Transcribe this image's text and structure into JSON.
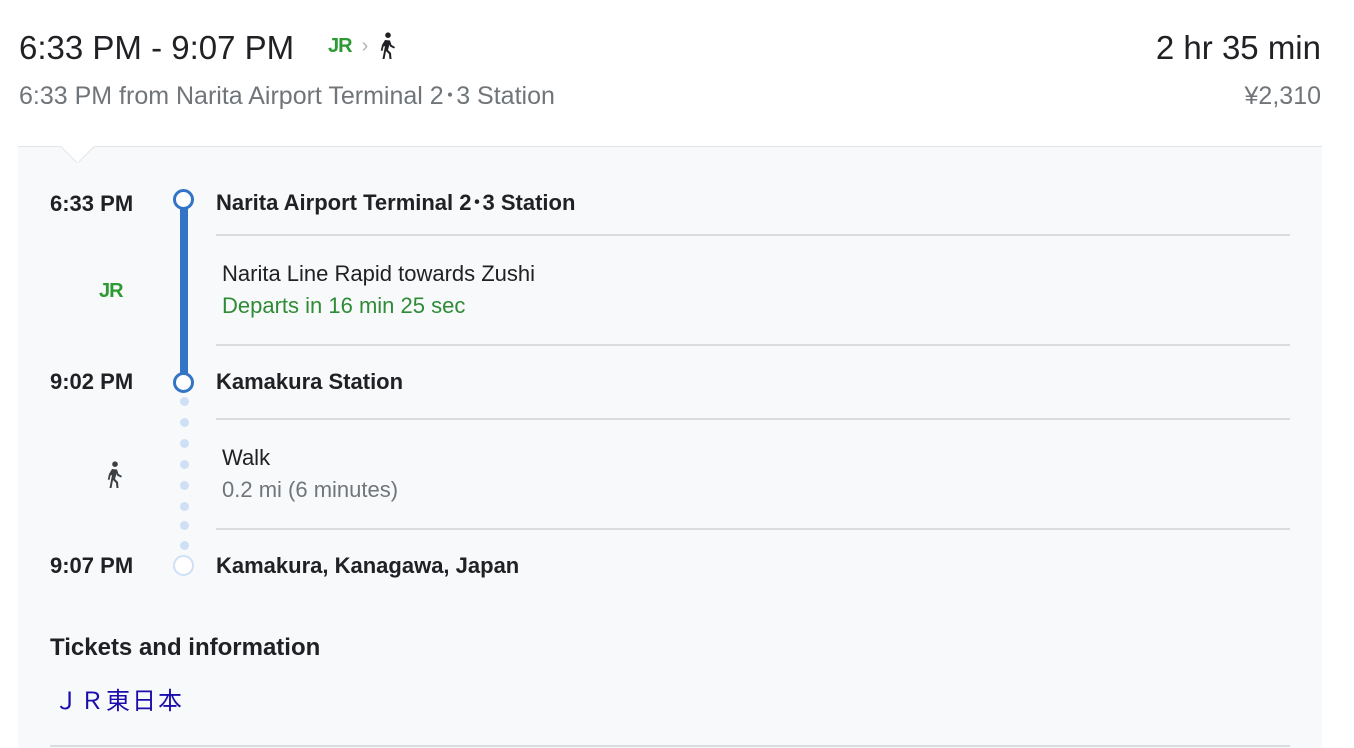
{
  "summary": {
    "time_range": "6:33 PM - 9:07 PM",
    "duration": "2 hr 35 min",
    "departure_info": "6:33 PM from Narita Airport Terminal 2･3 Station",
    "fare": "¥2,310",
    "mode_icons": [
      "jr-logo-icon",
      "chevron-right-icon",
      "walk-icon"
    ],
    "jr_logo_text": "JR",
    "chevron": "›"
  },
  "itinerary": {
    "origin": {
      "time": "6:33 PM",
      "name": "Narita Airport Terminal 2･3 Station"
    },
    "train_segment": {
      "icon": "jr-logo-icon",
      "jr_logo_text": "JR",
      "line": "Narita Line Rapid towards Zushi",
      "status": "Departs in 16 min 25 sec"
    },
    "transfer": {
      "time": "9:02 PM",
      "name": "Kamakura Station"
    },
    "walk_segment": {
      "icon": "walk-icon",
      "label": "Walk",
      "detail": "0.2 mi (6 minutes)"
    },
    "destination": {
      "time": "9:07 PM",
      "name": "Kamakura, Kanagawa, Japan"
    }
  },
  "tickets": {
    "heading": "Tickets and information",
    "link": "ＪＲ東日本"
  },
  "colors": {
    "jr_green": "#2e9a34",
    "rail_blue": "#3474c6",
    "walk_dots": "#cfe0f6",
    "status_green": "#2e8b36",
    "link_blue": "#1a0dab"
  }
}
